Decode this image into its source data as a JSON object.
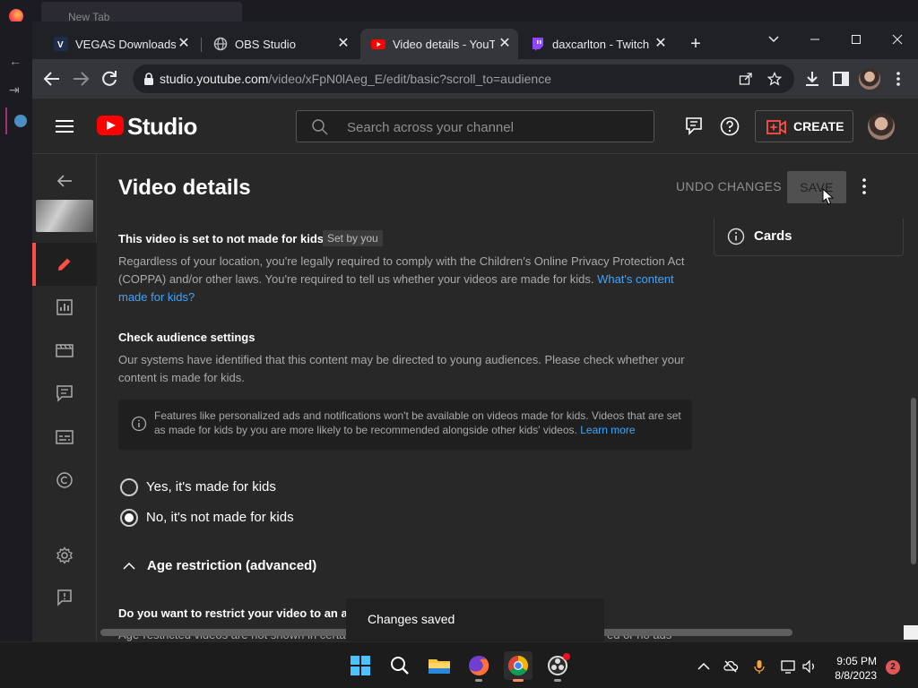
{
  "bg_firefox": {
    "tab_label": "New Tab"
  },
  "chrome": {
    "tabs": [
      {
        "label": "VEGAS Downloads | D",
        "favicon": "vegas-favicon"
      },
      {
        "label": "OBS Studio",
        "favicon": "globe-favicon"
      },
      {
        "label": "Video details - YouTu",
        "favicon": "youtube-favicon",
        "active": true
      },
      {
        "label": "daxcarlton - Twitch",
        "favicon": "twitch-favicon"
      }
    ],
    "url_host": "studio.youtube.com",
    "url_path": "/video/xFpN0lAeg_E/edit/basic?scroll_to=audience"
  },
  "studio": {
    "brand": "Studio",
    "search_placeholder": "Search across your channel",
    "create_label": "CREATE",
    "page_title": "Video details",
    "undo_label": "UNDO CHANGES",
    "save_label": "SAVE",
    "cards_label": "Cards",
    "kids_heading": "This video is set to not made for kids",
    "setby_chip": "Set by you",
    "kids_body": "Regardless of your location, you're legally required to comply with the Children's Online Privacy Protection Act (COPPA) and/or other laws. You're required to tell us whether your videos are made for kids.",
    "kids_link": "What's content made for kids?",
    "check_heading": "Check audience settings",
    "check_body": "Our systems have identified that this content may be directed to young audiences. Please check whether your content is made for kids.",
    "info_text": "Features like personalized ads and notifications won't be available on videos made for kids. Videos that are set as made for kids by you are more likely to be recommended alongside other kids' videos.",
    "info_link": "Learn more",
    "radio_yes": "Yes, it's made for kids",
    "radio_no": "No, it's not made for kids",
    "selected_option": "No, it's not made for kids",
    "age_toggle": "Age restriction (advanced)",
    "age_question": "Do you want to restrict your video to an adult audience?",
    "age_body_left": "Age-restricted videos are not shown in certa",
    "age_body_right": "ed or no ads",
    "toast": "Changes saved"
  },
  "taskbar": {
    "time": "9:05 PM",
    "date": "8/8/2023",
    "notifications": "2"
  },
  "colors": {
    "accent_red": "#ff0000",
    "link_blue": "#3ea6ff",
    "active_nav_bar": "#ff4e45"
  }
}
